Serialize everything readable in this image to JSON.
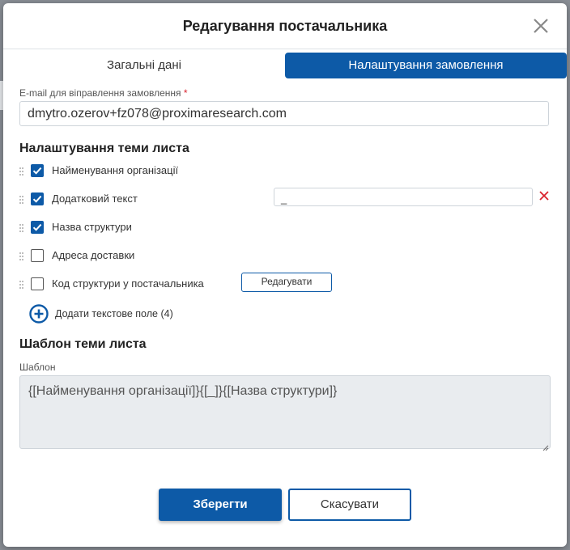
{
  "modal": {
    "title": "Редагування постачальника",
    "close_icon": "close-icon"
  },
  "tabs": [
    {
      "label": "Загальні дані",
      "active": false
    },
    {
      "label": "Налаштування замовлення",
      "active": true
    }
  ],
  "email": {
    "label": "E-mail для віправлення замовлення",
    "required_mark": "*",
    "value": "dmytro.ozerov+fz078@proximaresearch.com"
  },
  "subject_settings": {
    "title": "Налаштування теми листа",
    "items": [
      {
        "label": "Найменування організації",
        "checked": true
      },
      {
        "label": "Додатковий текст",
        "checked": true,
        "input_value": "_"
      },
      {
        "label": "Назва структури",
        "checked": true
      },
      {
        "label": "Адреса доставки",
        "checked": false
      },
      {
        "label": "Код структури у постачальника",
        "checked": false,
        "button_label": "Редагувати"
      }
    ],
    "add_field_label": "Додати текстове поле (4)"
  },
  "subject_template": {
    "title": "Шаблон теми листа",
    "field_label": "Шаблон",
    "value": "{[Найменування організації]}{[_]}{[Назва структури]}"
  },
  "footer": {
    "save_label": "Зберегти",
    "cancel_label": "Скасувати"
  },
  "colors": {
    "primary": "#0d5aa7",
    "danger": "#d9232e",
    "disabled_bg": "#e9ecef"
  }
}
